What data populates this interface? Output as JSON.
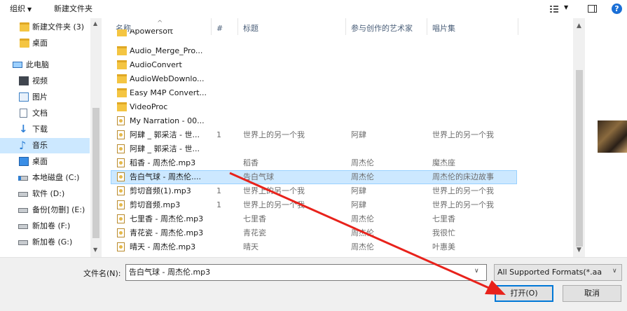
{
  "toolbar": {
    "organize_label": "组织",
    "new_folder_label": "新建文件夹",
    "help_glyph": "?"
  },
  "nav": {
    "items": [
      {
        "label": "新建文件夹 (3)",
        "icon": "folder-icon"
      },
      {
        "label": "桌面",
        "icon": "folder-icon"
      },
      {
        "label": "此电脑",
        "icon": "computer-icon"
      },
      {
        "label": "视频",
        "icon": "video-icon"
      },
      {
        "label": "图片",
        "icon": "pictures-icon"
      },
      {
        "label": "文档",
        "icon": "documents-icon"
      },
      {
        "label": "下载",
        "icon": "download-icon"
      },
      {
        "label": "音乐",
        "icon": "music-icon",
        "selected": true
      },
      {
        "label": "桌面",
        "icon": "desktop-icon"
      },
      {
        "label": "本地磁盘 (C:)",
        "icon": "drive-icon"
      },
      {
        "label": "软件 (D:)",
        "icon": "drive-icon"
      },
      {
        "label": "备份[勿删] (E:)",
        "icon": "drive-icon"
      },
      {
        "label": "新加卷 (F:)",
        "icon": "drive-icon"
      },
      {
        "label": "新加卷 (G:)",
        "icon": "drive-icon"
      }
    ]
  },
  "columns": {
    "name": "名称",
    "number": "#",
    "title": "标题",
    "artist": "参与创作的艺术家",
    "album": "唱片集"
  },
  "files": [
    {
      "name": "Apowersoft",
      "type": "folder",
      "num": "",
      "title": "",
      "artist": "",
      "album": ""
    },
    {
      "name": "Audio_Merge_Pro...",
      "type": "folder",
      "num": "",
      "title": "",
      "artist": "",
      "album": ""
    },
    {
      "name": "AudioConvert",
      "type": "folder",
      "num": "",
      "title": "",
      "artist": "",
      "album": ""
    },
    {
      "name": "AudioWebDownlo...",
      "type": "folder",
      "num": "",
      "title": "",
      "artist": "",
      "album": ""
    },
    {
      "name": "Easy M4P Convert...",
      "type": "folder",
      "num": "",
      "title": "",
      "artist": "",
      "album": ""
    },
    {
      "name": "VideoProc",
      "type": "folder",
      "num": "",
      "title": "",
      "artist": "",
      "album": ""
    },
    {
      "name": "My Narration - 00...",
      "type": "audio",
      "num": "",
      "title": "",
      "artist": "",
      "album": ""
    },
    {
      "name": "阿肆 _ 郭采洁 - 世...",
      "type": "audio",
      "num": "1",
      "title": "世界上的另一个我",
      "artist": "阿肆",
      "album": "世界上的另一个我"
    },
    {
      "name": "阿肆 _ 郭采洁 - 世...",
      "type": "audio",
      "num": "",
      "title": "",
      "artist": "",
      "album": ""
    },
    {
      "name": "稻香 - 周杰伦.mp3",
      "type": "audio",
      "num": "",
      "title": "稻香",
      "artist": "周杰伦",
      "album": "魔杰座"
    },
    {
      "name": "告白气球 - 周杰伦....",
      "type": "audio",
      "num": "",
      "title": "告白气球",
      "artist": "周杰伦",
      "album": "周杰伦的床边故事",
      "selected": true
    },
    {
      "name": "剪切音频(1).mp3",
      "type": "audio",
      "num": "1",
      "title": "世界上的另一个我",
      "artist": "阿肆",
      "album": "世界上的另一个我"
    },
    {
      "name": "剪切音频.mp3",
      "type": "audio",
      "num": "1",
      "title": "世界上的另一个我",
      "artist": "阿肆",
      "album": "世界上的另一个我"
    },
    {
      "name": "七里香 - 周杰伦.mp3",
      "type": "audio",
      "num": "",
      "title": "七里香",
      "artist": "周杰伦",
      "album": "七里香"
    },
    {
      "name": "青花瓷 - 周杰伦.mp3",
      "type": "audio",
      "num": "",
      "title": "青花瓷",
      "artist": "周杰伦",
      "album": "我很忙"
    },
    {
      "name": "晴天 - 周杰伦.mp3",
      "type": "audio",
      "num": "",
      "title": "晴天",
      "artist": "周杰伦",
      "album": "叶惠美"
    }
  ],
  "bottom": {
    "filename_label": "文件名(N):",
    "filename_value": "告白气球 - 周杰伦.mp3",
    "filter_value": "All Supported Formats(*.aa",
    "open_label": "打开(O)",
    "cancel_label": "取消"
  },
  "colors": {
    "selection": "#cce8ff",
    "annotation_arrow": "#e8221b",
    "accent": "#0078d7"
  }
}
